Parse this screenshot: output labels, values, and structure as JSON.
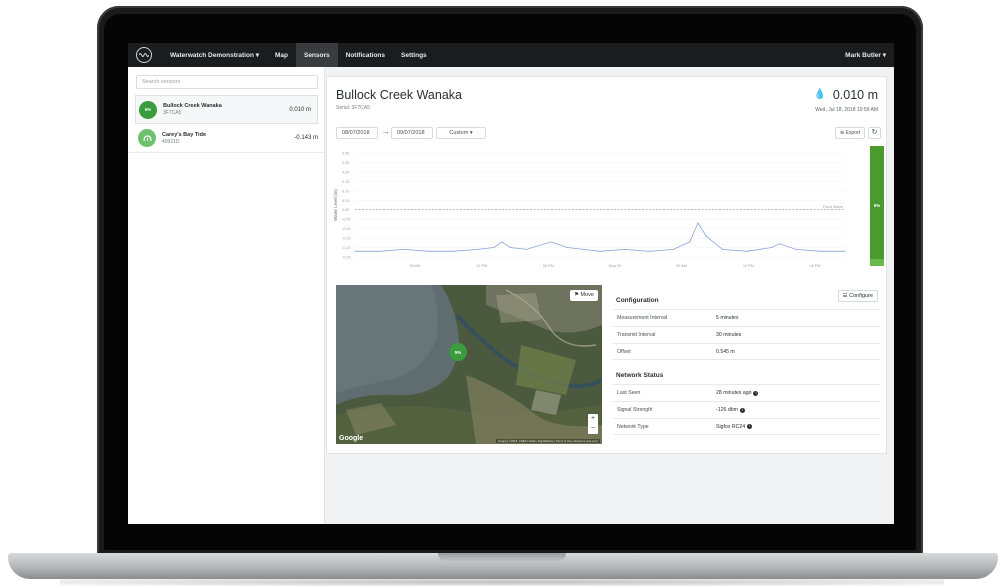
{
  "nav": {
    "org": "Waterwatch Demonstration ▾",
    "items": [
      "Map",
      "Sensors",
      "Notifications",
      "Settings"
    ],
    "active": "Sensors",
    "user": "Mark Butler ▾"
  },
  "sidebar": {
    "search_placeholder": "Search sensors",
    "sensors": [
      {
        "badge": "5%",
        "name": "Bullock Creek Wanaka",
        "serial": "3F7CA5",
        "value": "0.010 m",
        "selected": true
      },
      {
        "badge": "",
        "name": "Carey's Bay Tide",
        "serial": "40921D",
        "value": "-0.143 m",
        "selected": false
      }
    ]
  },
  "main": {
    "title": "Bullock Creek Wanaka",
    "serial": "Serial: 3F7CA5",
    "reading": "0.010 m",
    "reading_date": "Wed, Jul 18, 2018 10:59 AM",
    "date_from": "08/07/2018",
    "date_to": "09/07/2018",
    "range_select": "Custom ▾",
    "export_label": "Export",
    "level_percent": "5%",
    "level_fraction": 0.05
  },
  "chart_data": {
    "type": "line",
    "ylabel": "Water Level (m)",
    "y_ticks": [
      "0.30",
      "0.25",
      "0.20",
      "0.15",
      "0.10",
      "0.05",
      "0.00",
      "-0.05",
      "-0.10",
      "-0.15",
      "-0.20",
      "-0.25"
    ],
    "ylim": [
      -0.25,
      0.3
    ],
    "x_ticks": [
      "06 AM",
      "12 PM",
      "06 PM",
      "Mon 09",
      "06 AM",
      "12 PM",
      "06 PM"
    ],
    "threshold": {
      "label": "Flood Alarm",
      "value": 0.0
    },
    "series": [
      {
        "x": [
          0,
          3,
          6,
          9,
          12,
          15,
          17,
          18,
          19,
          21,
          24,
          26,
          28,
          30,
          33,
          36,
          39,
          41,
          42,
          43,
          45,
          48,
          51,
          52,
          54,
          57,
          60
        ],
        "values": [
          -0.22,
          -0.22,
          -0.21,
          -0.22,
          -0.22,
          -0.21,
          -0.2,
          -0.17,
          -0.2,
          -0.21,
          -0.17,
          -0.2,
          -0.21,
          -0.22,
          -0.21,
          -0.22,
          -0.21,
          -0.17,
          -0.07,
          -0.14,
          -0.21,
          -0.22,
          -0.2,
          -0.18,
          -0.21,
          -0.22,
          -0.22
        ]
      }
    ]
  },
  "map": {
    "move_label": "Move",
    "badge": "5%",
    "google": "Google",
    "attribution": "Imagery ©2018, CNES / Airbus, DigitalGlobe | Terms of Use | Report a map error"
  },
  "configuration": {
    "title": "Configuration",
    "button": "Configure",
    "rows": [
      {
        "label": "Measurement Interval",
        "value": "5 minutes"
      },
      {
        "label": "Transmit Interval",
        "value": "30 minutes"
      },
      {
        "label": "Offset",
        "value": "0.545 m"
      }
    ]
  },
  "network": {
    "title": "Network Status",
    "rows": [
      {
        "label": "Last Seen",
        "value": "28 minutes ago"
      },
      {
        "label": "Signal Strength",
        "value": "-126 dbm"
      },
      {
        "label": "Network Type",
        "value": "Sigfox RC24"
      }
    ]
  },
  "colors": {
    "accent": "#3b9c3e",
    "nav_bg": "#1b1c1e",
    "line": "#8aa4d8"
  }
}
